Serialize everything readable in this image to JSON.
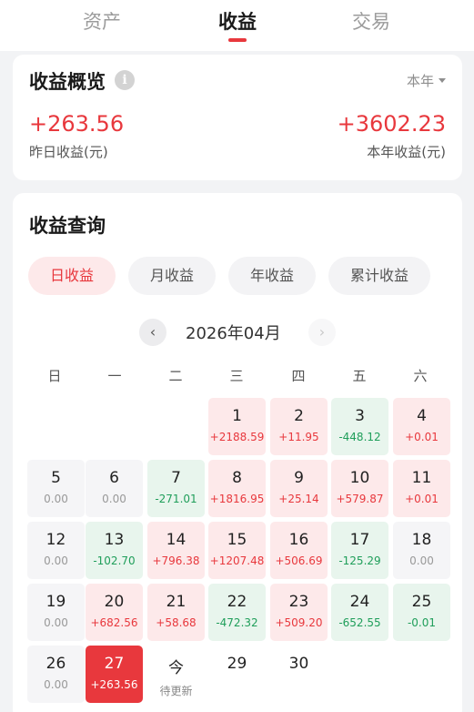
{
  "tabs": [
    {
      "label": "资产",
      "active": false
    },
    {
      "label": "收益",
      "active": true
    },
    {
      "label": "交易",
      "active": false
    }
  ],
  "overview": {
    "title": "收益概览",
    "info_icon": "i",
    "period": "本年",
    "yesterday_value": "+263.56",
    "yesterday_label": "昨日收益(元)",
    "year_value": "+3602.23",
    "year_label": "本年收益(元)"
  },
  "query": {
    "title": "收益查询",
    "chips": [
      "日收益",
      "月收益",
      "年收益",
      "累计收益"
    ],
    "active_chip": 0,
    "month": "2026年04月",
    "prev_icon": "‹",
    "next_icon": "›",
    "weekdays": [
      "日",
      "一",
      "二",
      "三",
      "四",
      "五",
      "六"
    ]
  },
  "calendar": [
    {
      "day": "1",
      "value": "+2188.59",
      "type": "pos"
    },
    {
      "day": "2",
      "value": "+11.95",
      "type": "pos"
    },
    {
      "day": "3",
      "value": "-448.12",
      "type": "neg"
    },
    {
      "day": "4",
      "value": "+0.01",
      "type": "pos"
    },
    {
      "day": "5",
      "value": "0.00",
      "type": "zero"
    },
    {
      "day": "6",
      "value": "0.00",
      "type": "zero"
    },
    {
      "day": "7",
      "value": "-271.01",
      "type": "neg"
    },
    {
      "day": "8",
      "value": "+1816.95",
      "type": "pos"
    },
    {
      "day": "9",
      "value": "+25.14",
      "type": "pos"
    },
    {
      "day": "10",
      "value": "+579.87",
      "type": "pos"
    },
    {
      "day": "11",
      "value": "+0.01",
      "type": "pos"
    },
    {
      "day": "12",
      "value": "0.00",
      "type": "zero"
    },
    {
      "day": "13",
      "value": "-102.70",
      "type": "neg"
    },
    {
      "day": "14",
      "value": "+796.38",
      "type": "pos"
    },
    {
      "day": "15",
      "value": "+1207.48",
      "type": "pos"
    },
    {
      "day": "16",
      "value": "+506.69",
      "type": "pos"
    },
    {
      "day": "17",
      "value": "-125.29",
      "type": "neg"
    },
    {
      "day": "18",
      "value": "0.00",
      "type": "zero"
    },
    {
      "day": "19",
      "value": "0.00",
      "type": "zero"
    },
    {
      "day": "20",
      "value": "+682.56",
      "type": "pos"
    },
    {
      "day": "21",
      "value": "+58.68",
      "type": "pos"
    },
    {
      "day": "22",
      "value": "-472.32",
      "type": "neg"
    },
    {
      "day": "23",
      "value": "+509.20",
      "type": "pos"
    },
    {
      "day": "24",
      "value": "-652.55",
      "type": "neg"
    },
    {
      "day": "25",
      "value": "-0.01",
      "type": "neg"
    },
    {
      "day": "26",
      "value": "0.00",
      "type": "zero"
    },
    {
      "day": "27",
      "value": "+263.56",
      "type": "today"
    },
    {
      "day": "今",
      "value": "待更新",
      "type": "pending"
    },
    {
      "day": "29",
      "value": "",
      "type": "future"
    },
    {
      "day": "30",
      "value": "",
      "type": "future"
    }
  ],
  "colors": {
    "accent_red": "#e8383d",
    "gain_red": "#e8383d",
    "loss_green": "#1f9e5a",
    "gain_bg": "#fde9ea",
    "loss_bg": "#e8f5ed"
  }
}
